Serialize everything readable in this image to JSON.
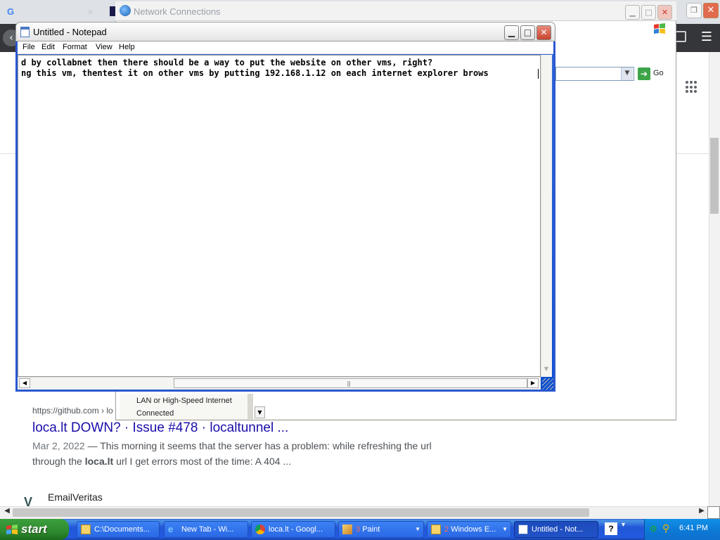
{
  "chrome": {
    "tab1_label": "",
    "tab1_icon": "google-g-icon",
    "tab1_close": "✕",
    "menu_icon": "☰"
  },
  "search_result": {
    "url": "https://github.com › lo",
    "title": "loca.lt DOWN? · Issue #478 · localtunnel ...",
    "date": "Mar 2, 2022",
    "snippet1": " — This morning it seems that the server has a problem: while refreshing the url",
    "snippet2_pre": "through the ",
    "snippet2_bold": "loca.lt",
    "snippet2_post": " url I get errors most of the time: A 404 ...",
    "next_site": "EmailVeritas"
  },
  "network_connections": {
    "title": "Network Connections",
    "go_label": "Go",
    "lan_line1": "LAN or High-Speed Internet",
    "lan_line2": "Connected"
  },
  "notepad": {
    "title": "Untitled - Notepad",
    "menus": [
      "File",
      "Edit",
      "Format",
      "View",
      "Help"
    ],
    "lines": [
      "d by collabnet then there should be a way to put the website on other vms, right?",
      "ng this vm, thentest it on other vms by putting 192.168.1.12 on each internet explorer brows"
    ]
  },
  "taskbar": {
    "start_label": "start",
    "tasks": [
      {
        "label": "C:\\Documents...",
        "icon": "folder-icon"
      },
      {
        "label": "New Tab - Wi...",
        "icon": "ie-icon"
      },
      {
        "label": "loca.lt - Googl...",
        "icon": "chrome-icon"
      },
      {
        "count": "3",
        "label": "Paint",
        "icon": "paint-icon"
      },
      {
        "count": "2",
        "label": "Windows E...",
        "icon": "folder-icon"
      },
      {
        "label": "Untitled - Not...",
        "icon": "notepad-icon"
      }
    ],
    "clock": "6:41 PM"
  },
  "colors": {
    "xp_taskbar": "#2157d7",
    "start_green": "#2f8a2f",
    "link_blue": "#1a0dab",
    "chrome_toolbar": "#35363a"
  }
}
